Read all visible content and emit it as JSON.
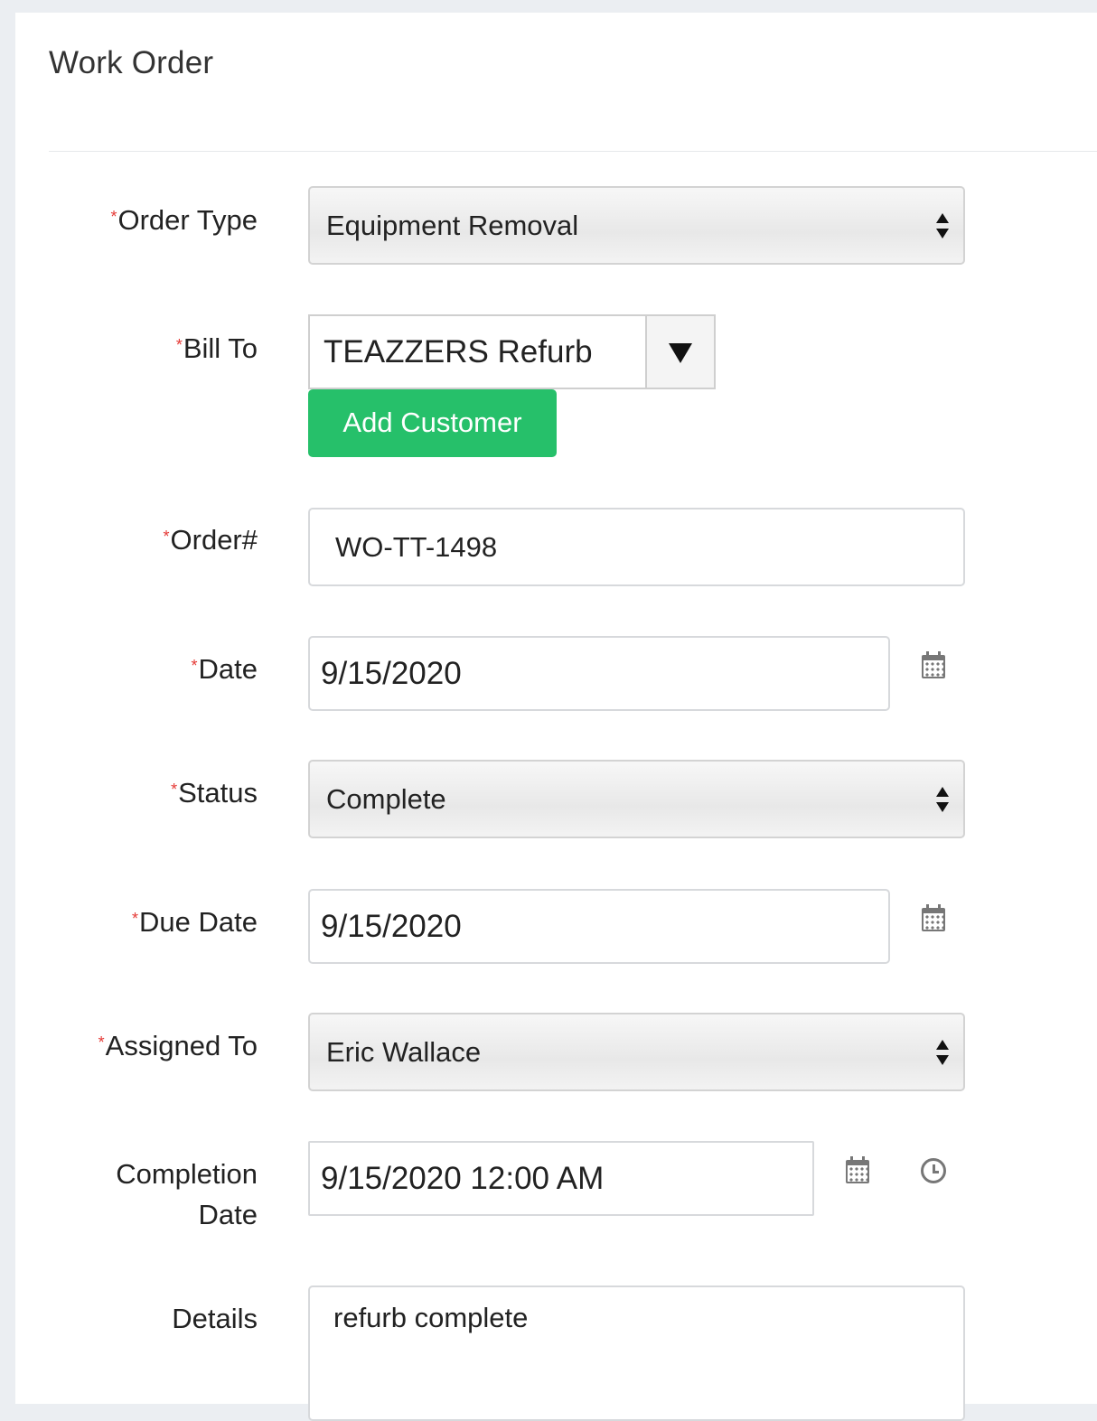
{
  "panel": {
    "title": "Work Order"
  },
  "required_mark": "*",
  "form": {
    "order_type": {
      "label": "Order Type",
      "value": "Equipment Removal"
    },
    "bill_to": {
      "label": "Bill To",
      "value": "TEAZZERS Refurb",
      "add_button": "Add Customer"
    },
    "order_number": {
      "label": "Order#",
      "value": "WO-TT-1498"
    },
    "date": {
      "label": "Date",
      "value": "9/15/2020"
    },
    "status": {
      "label": "Status",
      "value": "Complete"
    },
    "due_date": {
      "label": "Due Date",
      "value": "9/15/2020"
    },
    "assigned_to": {
      "label": "Assigned To",
      "value": "Eric Wallace"
    },
    "completion_date": {
      "label_line1": "Completion",
      "label_line2": "Date",
      "value": "9/15/2020 12:00 AM"
    },
    "details": {
      "label": "Details",
      "value": "refurb complete"
    }
  },
  "icons": {
    "calendar": "calendar-icon",
    "clock": "clock-icon",
    "select_arrows": "updown-icon",
    "dropdown": "caret-down-icon"
  },
  "colors": {
    "required": "#e53935",
    "add_button": "#26c06a"
  }
}
